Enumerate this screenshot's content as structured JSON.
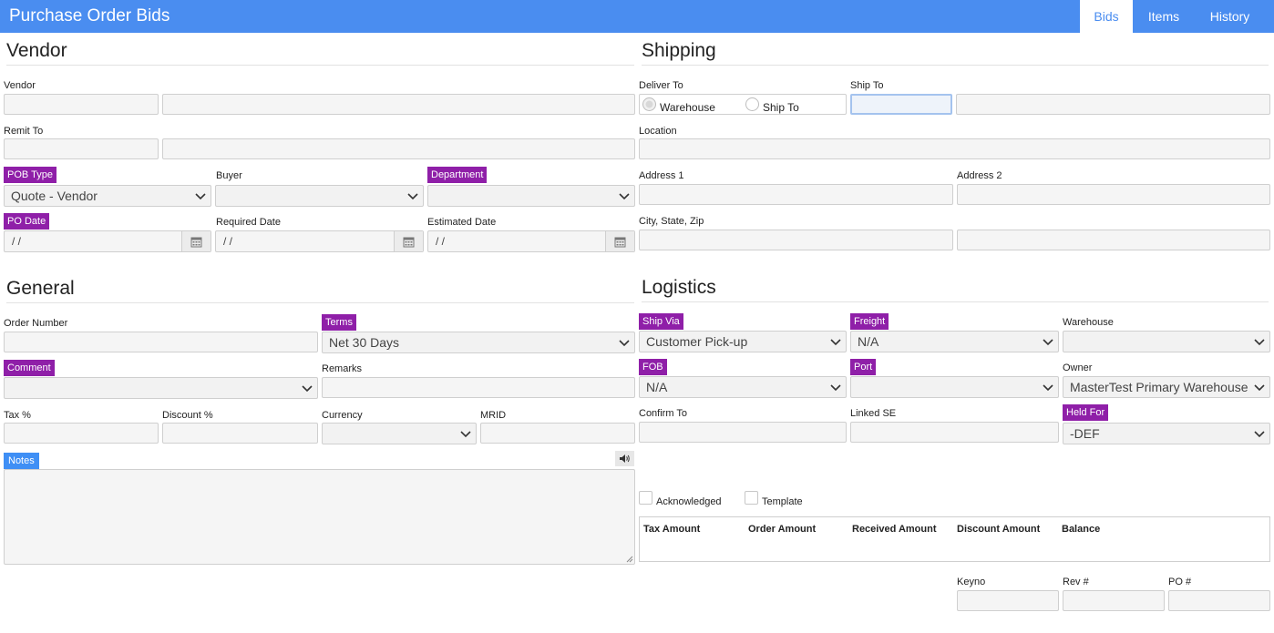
{
  "app": {
    "title": "Purchase Order Bids"
  },
  "tabs": {
    "bids": "Bids",
    "items": "Items",
    "history": "History"
  },
  "vendor": {
    "title": "Vendor",
    "vendor_label": "Vendor",
    "remit_to_label": "Remit To",
    "pob_type_label": "POB Type",
    "pob_type_value": "Quote - Vendor",
    "buyer_label": "Buyer",
    "buyer_value": "",
    "department_label": "Department",
    "department_value": "",
    "po_date_label": "PO Date",
    "po_date_value": "/  /",
    "required_date_label": "Required Date",
    "required_date_value": "/  /",
    "estimated_date_label": "Estimated Date",
    "estimated_date_value": "/  /"
  },
  "shipping": {
    "title": "Shipping",
    "deliver_to_label": "Deliver To",
    "warehouse_option": "Warehouse",
    "ship_to_option": "Ship To",
    "ship_to_label": "Ship To",
    "location_label": "Location",
    "address1_label": "Address 1",
    "address2_label": "Address 2",
    "city_state_zip_label": "City, State, Zip"
  },
  "general": {
    "title": "General",
    "order_number_label": "Order Number",
    "terms_label": "Terms",
    "terms_value": "Net 30 Days",
    "comment_label": "Comment",
    "comment_value": "",
    "remarks_label": "Remarks",
    "tax_label": "Tax %",
    "discount_label": "Discount %",
    "currency_label": "Currency",
    "currency_value": "",
    "mrid_label": "MRID",
    "notes_label": "Notes"
  },
  "logistics": {
    "title": "Logistics",
    "ship_via_label": "Ship Via",
    "ship_via_value": "Customer Pick-up",
    "freight_label": "Freight",
    "freight_value": "N/A",
    "warehouse_label": "Warehouse",
    "warehouse_value": "",
    "fob_label": "FOB",
    "fob_value": "N/A",
    "port_label": "Port",
    "port_value": "",
    "owner_label": "Owner",
    "owner_value": "MasterTest Primary Warehouse",
    "confirm_to_label": "Confirm To",
    "linked_se_label": "Linked SE",
    "held_for_label": "Held For",
    "held_for_value": "-DEF",
    "acknowledged_label": "Acknowledged",
    "template_label": "Template"
  },
  "summary": {
    "tax_amount": "Tax Amount",
    "order_amount": "Order Amount",
    "received_amount": "Received Amount",
    "discount_amount": "Discount Amount",
    "balance": "Balance"
  },
  "footer": {
    "keyno_label": "Keyno",
    "rev_label": "Rev #",
    "po_label": "PO #"
  },
  "colors": {
    "header": "#4a8df0",
    "required_label": "#8f1fa8",
    "notes_label": "#3f8ff5"
  }
}
